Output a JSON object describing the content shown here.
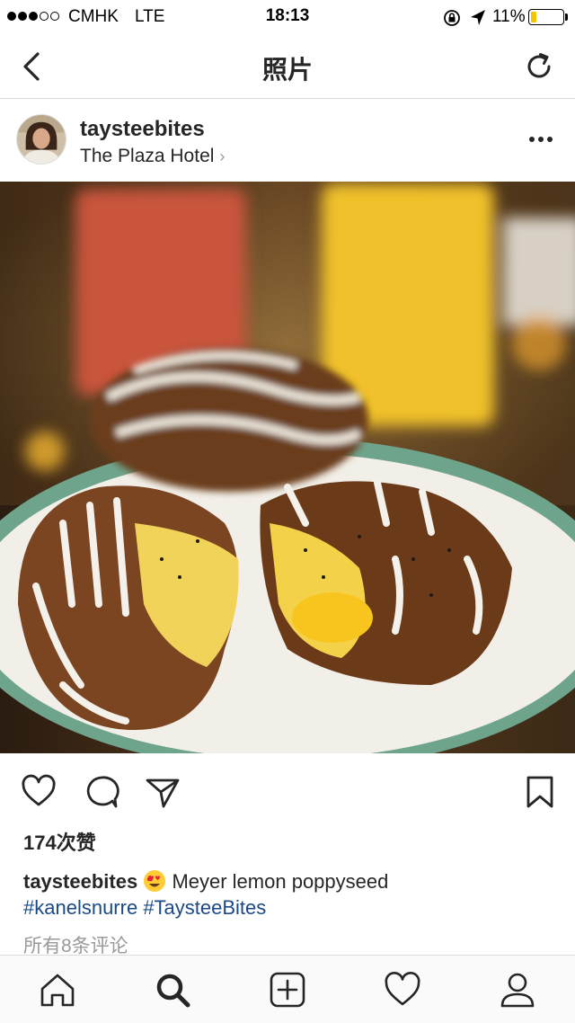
{
  "status_bar": {
    "carrier": "CMHK",
    "network": "LTE",
    "time": "18:13",
    "battery_percent": "11%",
    "battery_level": 0.11,
    "signal_bars_filled": 3,
    "signal_bars_total": 5
  },
  "nav": {
    "title": "照片",
    "back_icon": "chevron-left-icon",
    "refresh_icon": "refresh-icon"
  },
  "post": {
    "username": "taysteebites",
    "location": "The Plaza Hotel",
    "more_icon": "more-horizontal-icon",
    "photo_description_icon": "pastry-photo",
    "likes": "174次赞",
    "caption": {
      "username": "taysteebites",
      "emoji": "heart-eyes-emoji",
      "text": " Meyer lemon poppyseed",
      "hashtags": [
        "#kanelsnurre",
        "#TaysteeBites"
      ]
    },
    "view_comments": "所有8条评论"
  },
  "tab_bar": {
    "items": [
      "home-icon",
      "search-icon",
      "new-post-icon",
      "activity-icon",
      "profile-icon"
    ],
    "active": "search-icon"
  },
  "colors": {
    "text": "#262626",
    "hashtag": "#1b4a86",
    "muted": "#999999",
    "battery": "#f5c400",
    "border": "#dbdbdb"
  }
}
